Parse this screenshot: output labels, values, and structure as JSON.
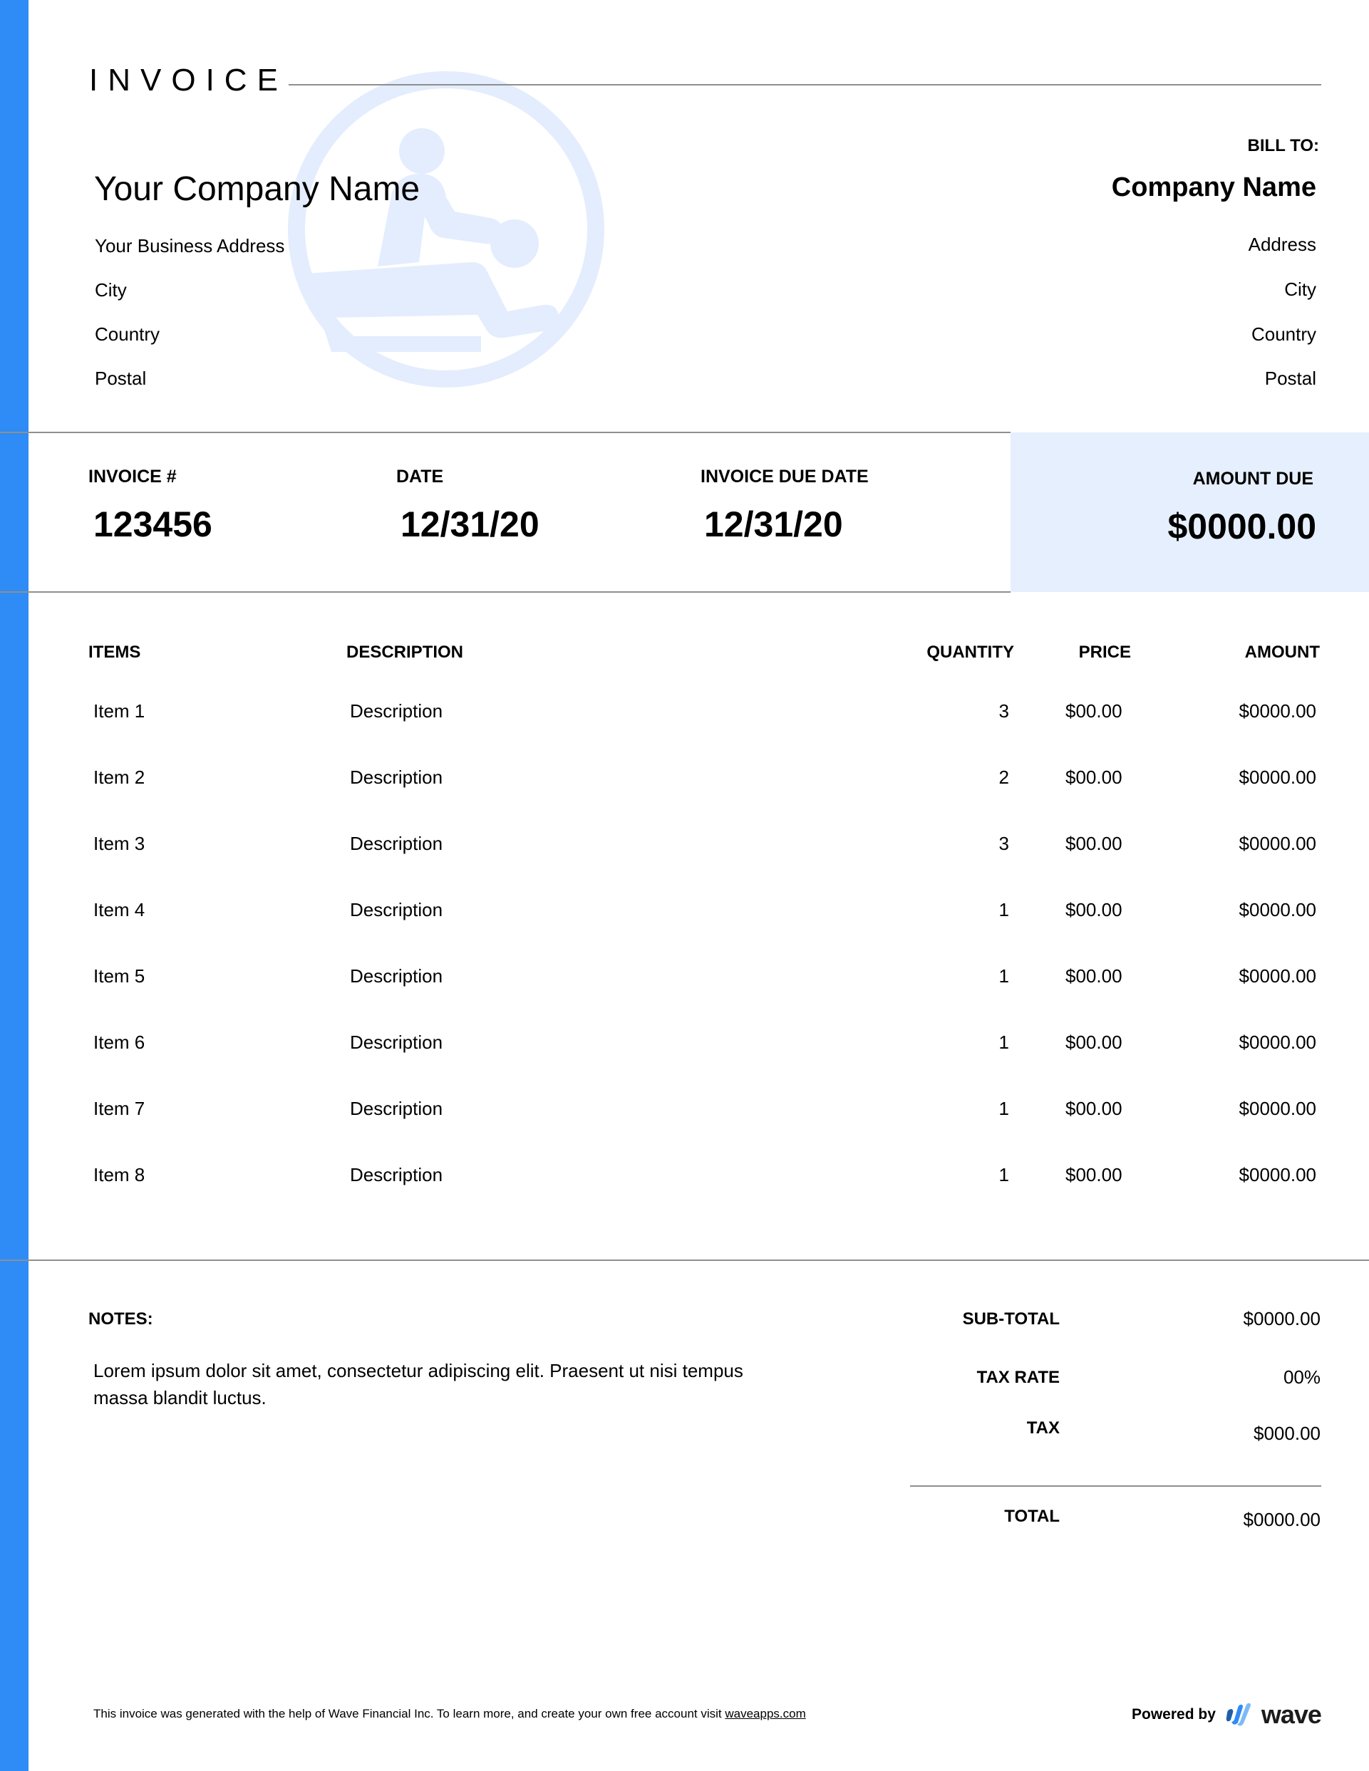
{
  "colors": {
    "accent": "#2F8BF5",
    "amount_box": "#E6EFFD",
    "watermark": "#E3EDFD",
    "divider": "#8F8F8F"
  },
  "header": {
    "title": "INVOICE",
    "watermark_icon": "massage-icon"
  },
  "from": {
    "company_name": "Your Company Name",
    "address": "Your Business Address",
    "city": "City",
    "country": "Country",
    "postal": "Postal"
  },
  "bill_to": {
    "label": "BILL TO:",
    "company_name": "Company Name",
    "address": "Address",
    "city": "City",
    "country": "Country",
    "postal": "Postal"
  },
  "meta": {
    "invoice_number_label": "INVOICE #",
    "invoice_number": "123456",
    "date_label": "DATE",
    "date": "12/31/20",
    "due_date_label": "INVOICE DUE DATE",
    "due_date": "12/31/20",
    "amount_due_label": "AMOUNT DUE",
    "amount_due": "$0000.00"
  },
  "table": {
    "headers": {
      "items": "ITEMS",
      "description": "DESCRIPTION",
      "quantity": "QUANTITY",
      "price": "PRICE",
      "amount": "AMOUNT"
    },
    "rows": [
      {
        "item": "Item 1",
        "description": "Description",
        "quantity": "3",
        "price": "$00.00",
        "amount": "$0000.00"
      },
      {
        "item": "Item 2",
        "description": "Description",
        "quantity": "2",
        "price": "$00.00",
        "amount": "$0000.00"
      },
      {
        "item": "Item 3",
        "description": "Description",
        "quantity": "3",
        "price": "$00.00",
        "amount": "$0000.00"
      },
      {
        "item": "Item 4",
        "description": "Description",
        "quantity": "1",
        "price": "$00.00",
        "amount": "$0000.00"
      },
      {
        "item": "Item 5",
        "description": "Description",
        "quantity": "1",
        "price": "$00.00",
        "amount": "$0000.00"
      },
      {
        "item": "Item 6",
        "description": "Description",
        "quantity": "1",
        "price": "$00.00",
        "amount": "$0000.00"
      },
      {
        "item": "Item 7",
        "description": "Description",
        "quantity": "1",
        "price": "$00.00",
        "amount": "$0000.00"
      },
      {
        "item": "Item 8",
        "description": "Description",
        "quantity": "1",
        "price": "$00.00",
        "amount": "$0000.00"
      }
    ]
  },
  "notes": {
    "label": "NOTES:",
    "body": "Lorem ipsum dolor sit amet, consectetur adipiscing elit. Praesent ut nisi tempus massa blandit luctus."
  },
  "totals": {
    "subtotal_label": "SUB-TOTAL",
    "subtotal": "$0000.00",
    "tax_rate_label": "TAX RATE",
    "tax_rate": "00%",
    "tax_label": "TAX",
    "tax": "$000.00",
    "total_label": "TOTAL",
    "total": "$0000.00"
  },
  "footer": {
    "text": "This invoice was generated with the help of Wave Financial Inc. To learn more, and create your own free account visit ",
    "link_text": "waveapps.com",
    "powered_by": "Powered by",
    "brand": "wave"
  }
}
